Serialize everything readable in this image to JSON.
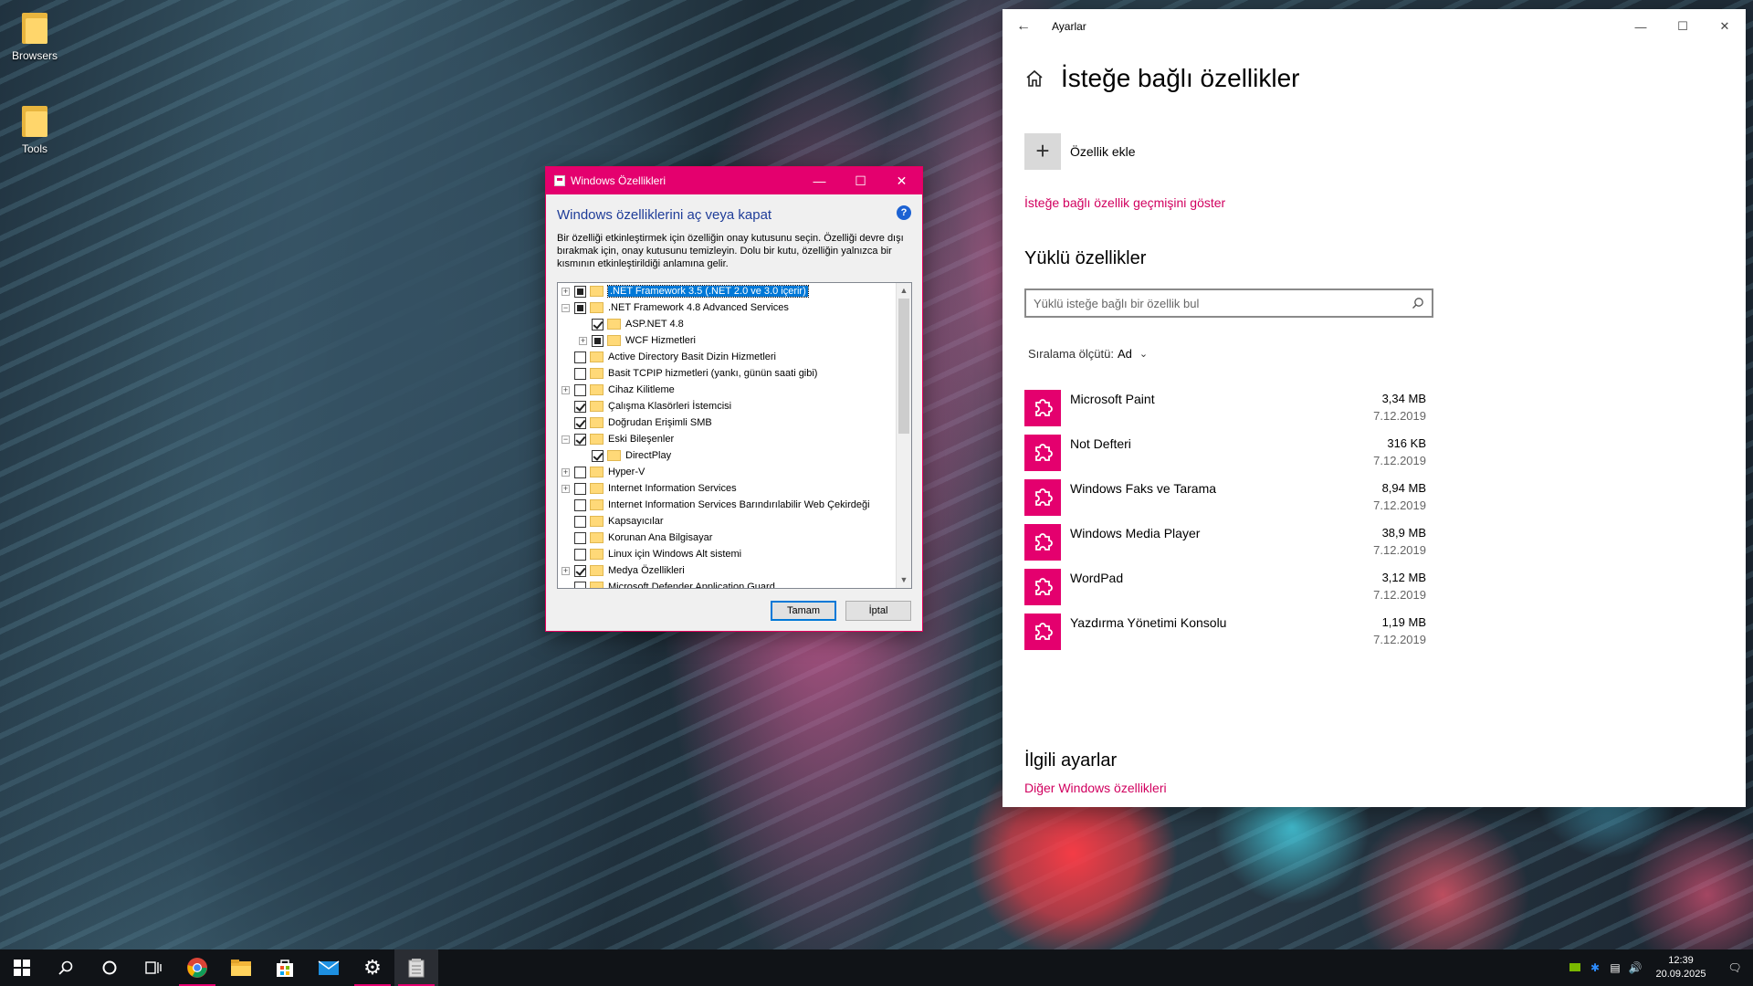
{
  "desktop": {
    "icons": [
      {
        "label": "Browsers"
      },
      {
        "label": "Tools"
      }
    ]
  },
  "features_dialog": {
    "title": "Windows Özellikleri",
    "heading": "Windows özelliklerini aç veya kapat",
    "help": "?",
    "description": "Bir özelliği etkinleştirmek için özelliğin onay kutusunu seçin. Özelliği devre dışı bırakmak için, onay kutusunu temizleyin. Dolu bir kutu, özelliğin yalnızca bir kısmının etkinleştirildiği anlamına gelir.",
    "items": [
      {
        "label": ".NET Framework 3.5 (.NET 2.0 ve 3.0 içerir)",
        "state": "partial",
        "expander": "+",
        "indent": 0,
        "selected": true
      },
      {
        "label": ".NET Framework 4.8 Advanced Services",
        "state": "partial",
        "expander": "−",
        "indent": 0,
        "selected": false
      },
      {
        "label": "ASP.NET 4.8",
        "state": "checked",
        "expander": "",
        "indent": 1,
        "selected": false
      },
      {
        "label": "WCF Hizmetleri",
        "state": "partial",
        "expander": "+",
        "indent": 1,
        "selected": false
      },
      {
        "label": "Active Directory Basit Dizin Hizmetleri",
        "state": "unchecked",
        "expander": "",
        "indent": 0,
        "selected": false
      },
      {
        "label": "Basit TCPIP hizmetleri (yankı, günün saati gibi)",
        "state": "unchecked",
        "expander": "",
        "indent": 0,
        "selected": false
      },
      {
        "label": "Cihaz Kilitleme",
        "state": "unchecked",
        "expander": "+",
        "indent": 0,
        "selected": false
      },
      {
        "label": "Çalışma Klasörleri İstemcisi",
        "state": "checked",
        "expander": "",
        "indent": 0,
        "selected": false
      },
      {
        "label": "Doğrudan Erişimli SMB",
        "state": "checked",
        "expander": "",
        "indent": 0,
        "selected": false
      },
      {
        "label": "Eski Bileşenler",
        "state": "checked",
        "expander": "−",
        "indent": 0,
        "selected": false
      },
      {
        "label": "DirectPlay",
        "state": "checked",
        "expander": "",
        "indent": 1,
        "selected": false
      },
      {
        "label": "Hyper-V",
        "state": "unchecked",
        "expander": "+",
        "indent": 0,
        "selected": false
      },
      {
        "label": "Internet Information Services",
        "state": "unchecked",
        "expander": "+",
        "indent": 0,
        "selected": false
      },
      {
        "label": "Internet Information Services Barındırılabilir Web Çekirdeği",
        "state": "unchecked",
        "expander": "",
        "indent": 0,
        "selected": false
      },
      {
        "label": "Kapsayıcılar",
        "state": "unchecked",
        "expander": "",
        "indent": 0,
        "selected": false
      },
      {
        "label": "Korunan Ana Bilgisayar",
        "state": "unchecked",
        "expander": "",
        "indent": 0,
        "selected": false
      },
      {
        "label": "Linux için Windows Alt sistemi",
        "state": "unchecked",
        "expander": "",
        "indent": 0,
        "selected": false
      },
      {
        "label": "Medya Özellikleri",
        "state": "checked",
        "expander": "+",
        "indent": 0,
        "selected": false
      },
      {
        "label": "Microsoft Defender Application Guard",
        "state": "unchecked",
        "expander": "",
        "indent": 0,
        "selected": false
      }
    ],
    "ok_label": "Tamam",
    "cancel_label": "İptal"
  },
  "settings": {
    "window_title": "Ayarlar",
    "page_title": "İsteğe bağlı özellikler",
    "add_feature_label": "Özellik ekle",
    "history_link": "İsteğe bağlı özellik geçmişini göster",
    "installed_heading": "Yüklü özellikler",
    "search_placeholder": "Yüklü isteğe bağlı bir özellik bul",
    "sort_label": "Sıralama ölçütü:",
    "sort_value": "Ad",
    "features": [
      {
        "name": "Microsoft Paint",
        "size": "3,34 MB",
        "date": "7.12.2019"
      },
      {
        "name": "Not Defteri",
        "size": "316 KB",
        "date": "7.12.2019"
      },
      {
        "name": "Windows Faks ve Tarama",
        "size": "8,94 MB",
        "date": "7.12.2019"
      },
      {
        "name": "Windows Media Player",
        "size": "38,9 MB",
        "date": "7.12.2019"
      },
      {
        "name": "WordPad",
        "size": "3,12 MB",
        "date": "7.12.2019"
      },
      {
        "name": "Yazdırma Yönetimi Konsolu",
        "size": "1,19 MB",
        "date": "7.12.2019"
      }
    ],
    "related_heading": "İlgili ayarlar",
    "related_link": "Diğer Windows özellikleri"
  },
  "taskbar": {
    "time": "12:39",
    "date": "20.09.2025"
  },
  "colors": {
    "accent": "#e4006e",
    "link": "#d1005f",
    "selection": "#0078d7"
  }
}
